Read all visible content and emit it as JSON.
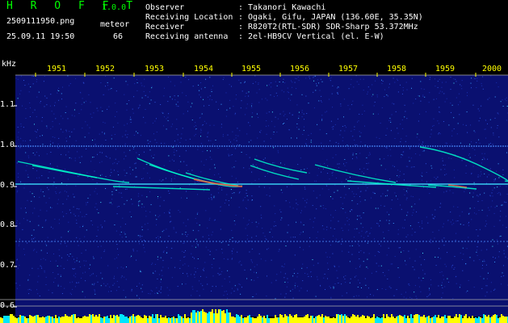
{
  "app": {
    "brand": "H R O F F T",
    "version": "1.0.0"
  },
  "file": {
    "name": "2509111950.png",
    "timestamp": "25.09.11 19:50"
  },
  "meteor": {
    "label": "meteor",
    "count": "66"
  },
  "info": [
    {
      "key": "Observer",
      "value": ": Takanori Kawachi"
    },
    {
      "key": "Receiving Location",
      "value": ": Ogaki, Gifu, JAPAN (136.60E, 35.35N)"
    },
    {
      "key": "Receiver",
      "value": ": R820T2(RTL-SDR) SDR-Sharp 53.372MHz"
    },
    {
      "key": "Receiving antenna",
      "value": ": 2el-HB9CV Vertical (el. E-W)"
    }
  ],
  "axis": {
    "y_unit": "kHz",
    "y_ticks": [
      "1.1",
      "1.0",
      "0.9",
      "0.8",
      "0.7",
      "0.6"
    ],
    "x_ticks": [
      "1951",
      "1952",
      "1953",
      "1954",
      "1955",
      "1956",
      "1957",
      "1958",
      "1959",
      "2000"
    ]
  },
  "colors": {
    "background": "#000000",
    "plot_bg": "#0a1070",
    "grid": "#aaaaaa",
    "header_text": "#ffffff",
    "header_accent": "#00ff00",
    "tick_x": "#ffff00",
    "trace": "#00ffcc",
    "bar_primary": "#ffff00",
    "bar_secondary": "#00e5ff"
  }
}
